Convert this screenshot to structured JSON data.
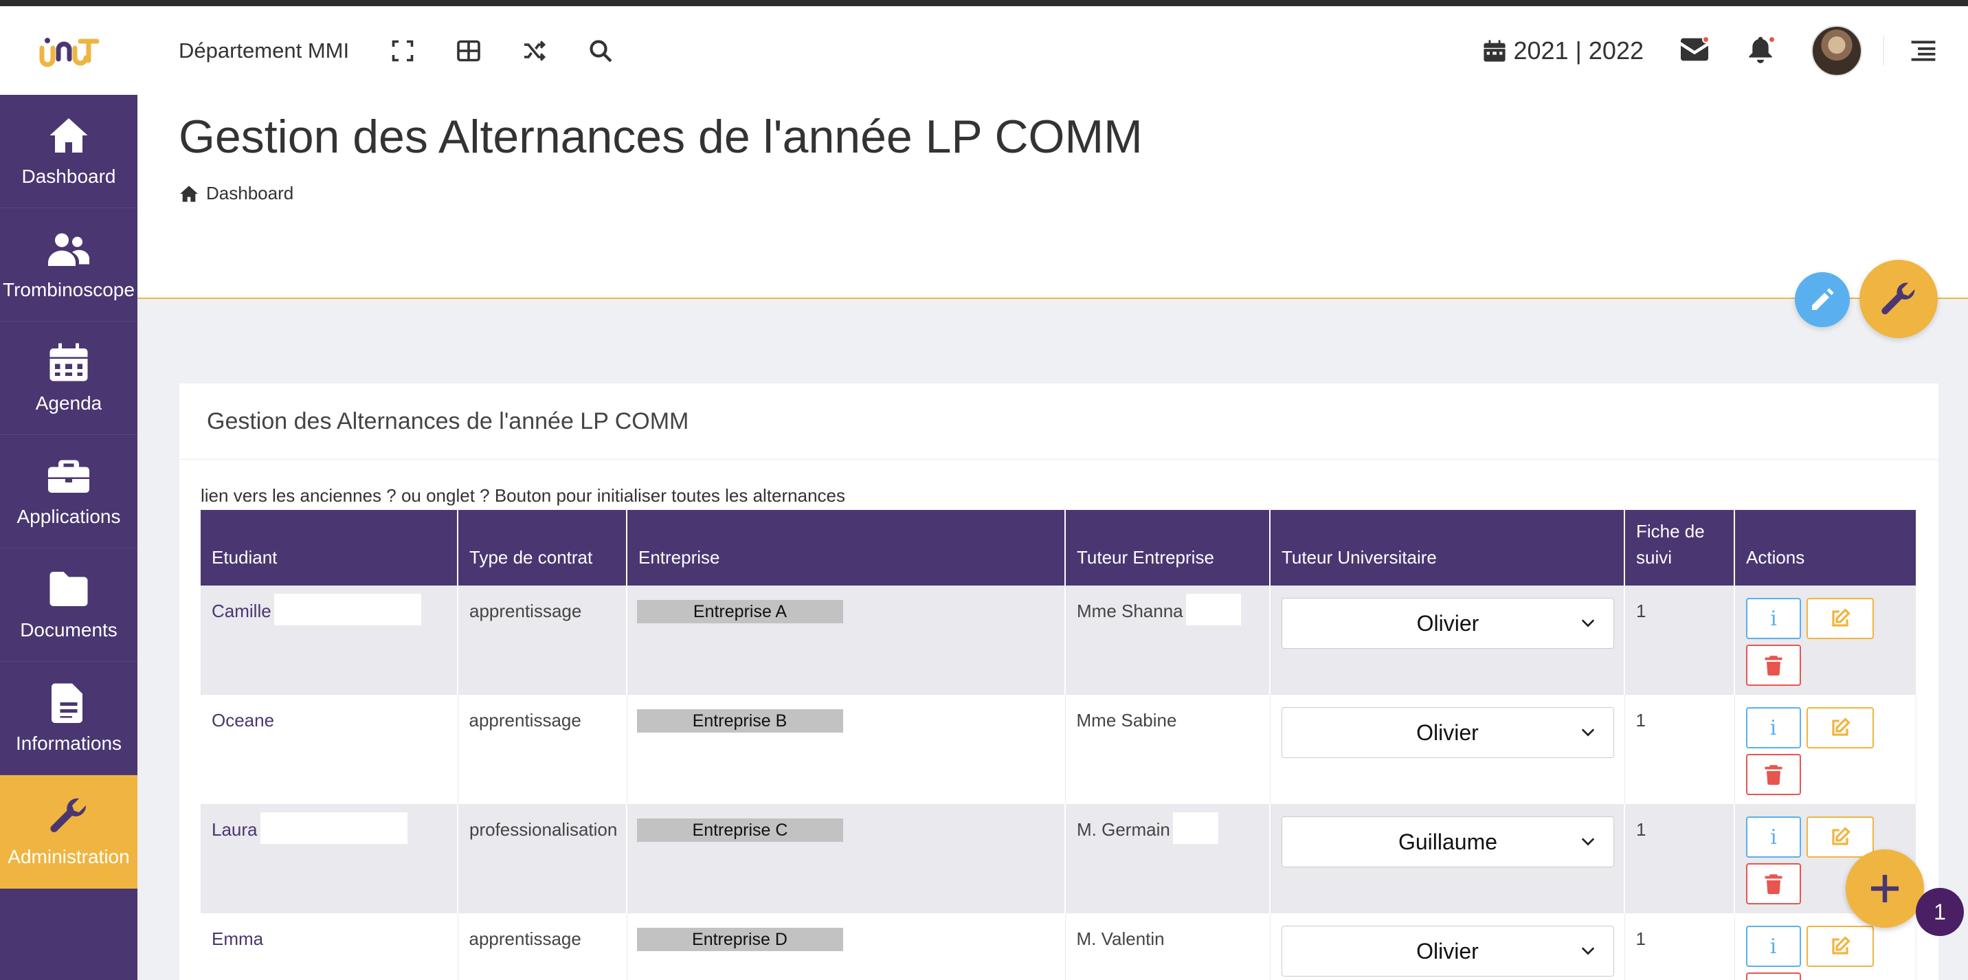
{
  "header": {
    "department": "Département MMI",
    "year": "2021 | 2022",
    "icons": [
      "fullscreen-icon",
      "grid-icon",
      "shuffle-icon",
      "search-icon",
      "calendar-icon",
      "mail-icon",
      "bell-icon",
      "menu-icon"
    ]
  },
  "sidebar": {
    "items": [
      {
        "label": "Dashboard",
        "icon": "home-icon"
      },
      {
        "label": "Trombinoscope",
        "icon": "users-icon"
      },
      {
        "label": "Agenda",
        "icon": "calendar-icon"
      },
      {
        "label": "Applications",
        "icon": "briefcase-icon"
      },
      {
        "label": "Documents",
        "icon": "folder-icon"
      },
      {
        "label": "Informations",
        "icon": "file-text-icon"
      },
      {
        "label": "Administration",
        "icon": "wrench-icon",
        "active": true
      }
    ]
  },
  "page": {
    "title": "Gestion des Alternances de l'année LP COMM",
    "breadcrumb": "Dashboard"
  },
  "card": {
    "title": "Gestion des Alternances de l'année LP COMM",
    "note": "lien vers les anciennes ? ou onglet ? Bouton pour initialiser toutes les alternances"
  },
  "table": {
    "headers": [
      "Etudiant",
      "Type de contrat",
      "Entreprise",
      "Tuteur Entreprise",
      "Tuteur Universitaire",
      "Fiche de suivi",
      "Actions"
    ],
    "rows": [
      {
        "student": "Camille",
        "contract": "apprentissage",
        "company": "Entreprise A",
        "tutor_company": "Mme Shanna",
        "tutor_univ": "Olivier",
        "fiche": "1"
      },
      {
        "student": "Oceane",
        "contract": "apprentissage",
        "company": "Entreprise B",
        "tutor_company": "Mme Sabine",
        "tutor_univ": "Olivier",
        "fiche": "1"
      },
      {
        "student": "Laura",
        "contract": "professionalisation",
        "company": "Entreprise C",
        "tutor_company": "M. Germain",
        "tutor_univ": "Guillaume",
        "fiche": "1"
      },
      {
        "student": "Emma",
        "contract": "apprentissage",
        "company": "Entreprise D",
        "tutor_company": "M. Valentin",
        "tutor_univ": "Olivier",
        "fiche": "1"
      }
    ],
    "action_info_label": "i"
  },
  "fab": {
    "badge": "1"
  },
  "colors": {
    "primary": "#4a3671",
    "accent": "#efb540",
    "info": "#5ab0ee",
    "danger": "#e8554f"
  }
}
